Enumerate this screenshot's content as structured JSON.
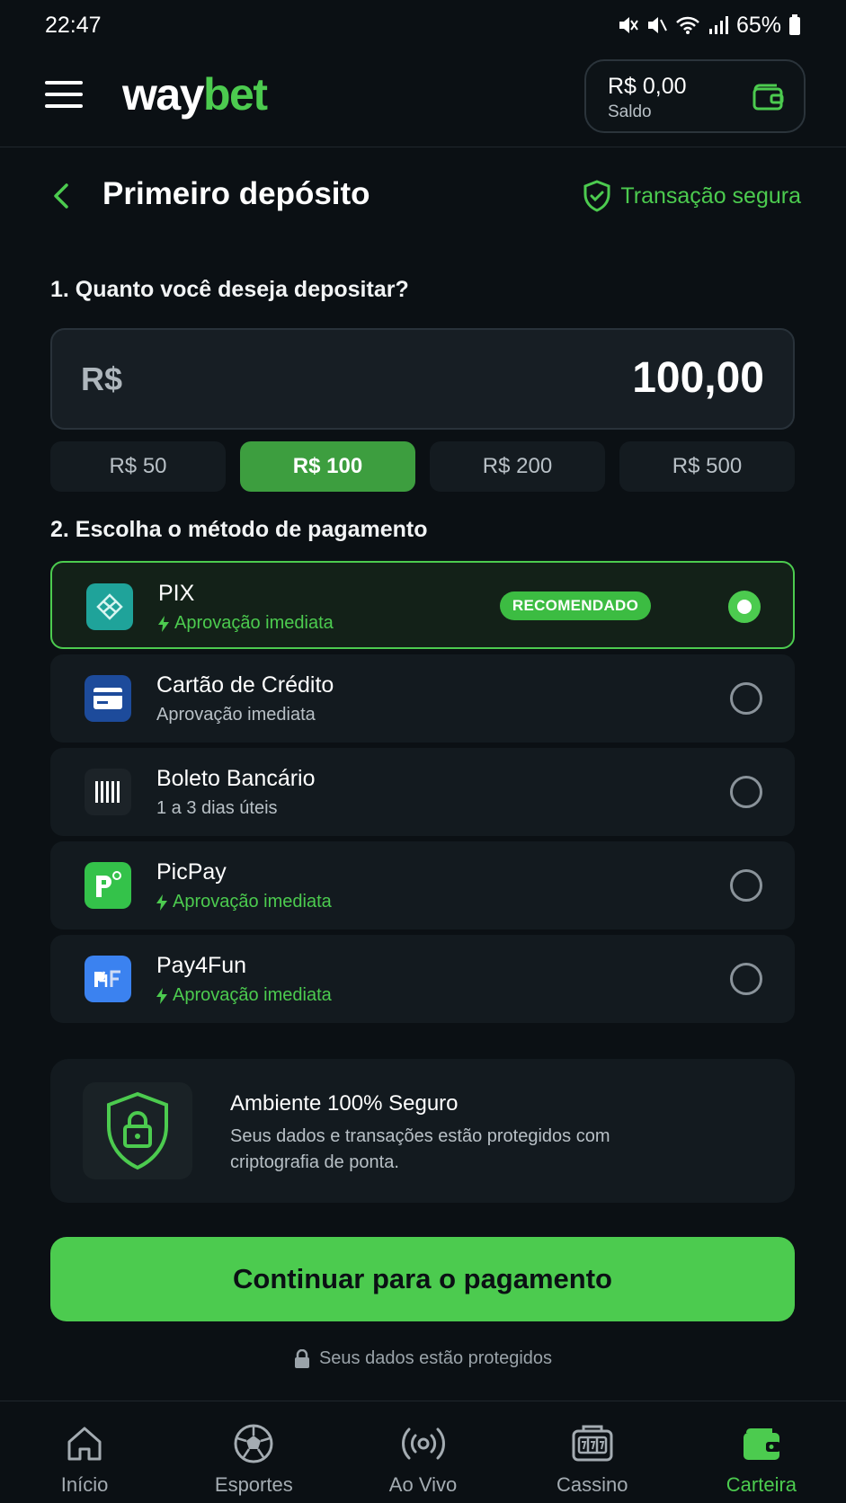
{
  "status_bar": {
    "time": "22:47",
    "battery": "65%"
  },
  "header": {
    "logo_part1": "way",
    "logo_part2": "bet",
    "balance_amount": "R$ 0,00",
    "balance_label": "Saldo"
  },
  "page": {
    "title": "Primeiro depósito",
    "secure_label": "Transação segura"
  },
  "amount_section": {
    "title": "1. Quanto você deseja depositar?",
    "currency": "R$",
    "value": "100,00",
    "presets": [
      "R$ 50",
      "R$ 100",
      "R$ 200",
      "R$ 500"
    ],
    "selected_preset": "R$ 100"
  },
  "payment_section": {
    "title": "2. Escolha o método de pagamento",
    "methods": [
      {
        "name": "PIX",
        "subtitle": "Aprovação imediata",
        "badge": "RECOMENDADO",
        "selected": true,
        "icon": "pix-icon"
      },
      {
        "name": "Cartão de Crédito",
        "subtitle": "Aprovação imediata",
        "selected": false,
        "icon": "credit-card-icon"
      },
      {
        "name": "Boleto Bancário",
        "subtitle": "1 a 3 dias úteis",
        "selected": false,
        "icon": "barcode-icon"
      },
      {
        "name": "PicPay",
        "subtitle": "Aprovação imediata",
        "selected": false,
        "icon": "picpay-icon"
      },
      {
        "name": "Pay4Fun",
        "subtitle": "Aprovação imediata",
        "selected": false,
        "icon": "pay4fun-icon"
      }
    ]
  },
  "secure_card": {
    "title": "Ambiente 100% Seguro",
    "text": "Seus dados e transações estão protegidos com criptografia de ponta."
  },
  "continue_button": "Continuar para o pagamento",
  "protected_note": "Seus dados estão protegidos",
  "bottom_nav": [
    {
      "label": "Início",
      "icon": "home-icon",
      "active": false
    },
    {
      "label": "Esportes",
      "icon": "soccer-ball-icon",
      "active": false
    },
    {
      "label": "Ao Vivo",
      "icon": "live-broadcast-icon",
      "active": false
    },
    {
      "label": "Cassino",
      "icon": "slot-machine-icon",
      "active": false
    },
    {
      "label": "Carteira",
      "icon": "wallet-icon",
      "active": true
    }
  ],
  "colors": {
    "accent": "#4ccb4f",
    "background": "#0b1014",
    "card": "#131a1f"
  }
}
